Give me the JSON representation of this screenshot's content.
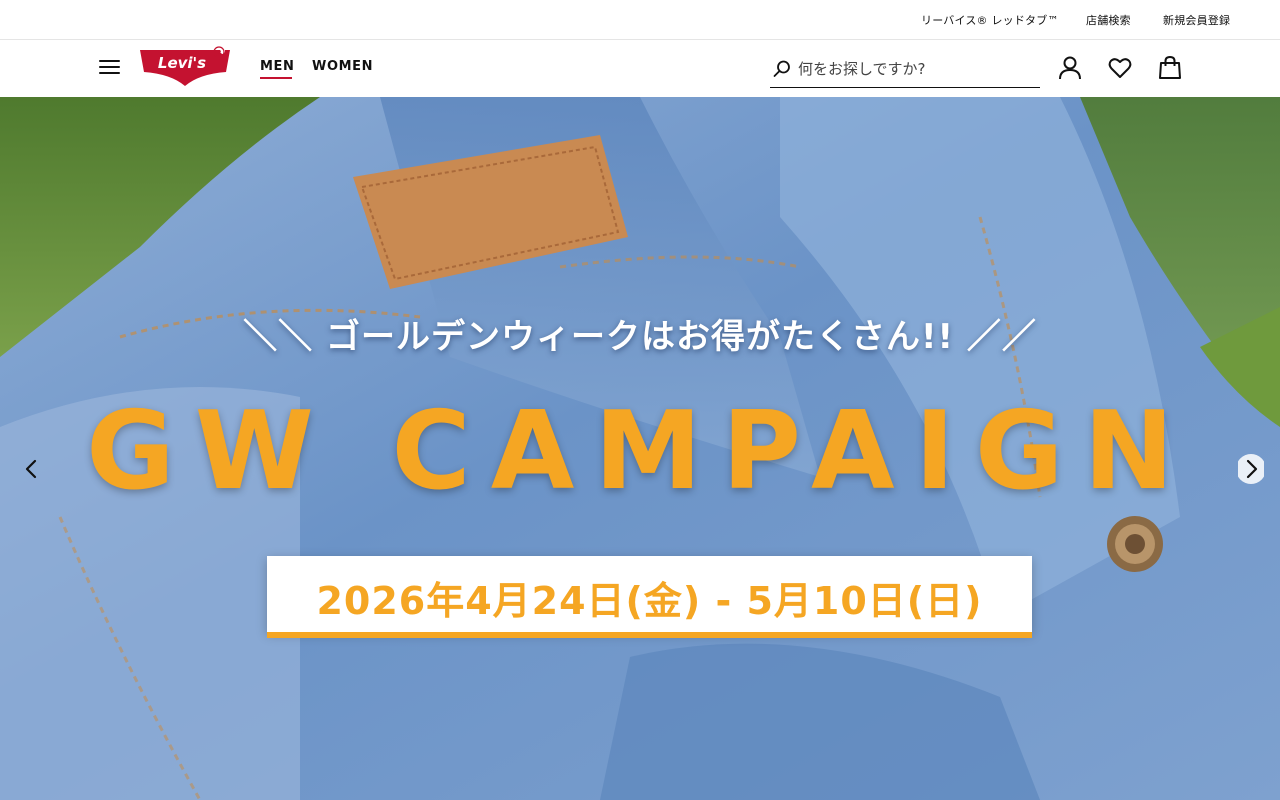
{
  "utility_bar": {
    "links": [
      {
        "label": "リーバイス® レッドタブ™"
      },
      {
        "label": "店舗検索"
      },
      {
        "label": "新規会員登録"
      }
    ]
  },
  "header": {
    "logo_text": "Levi's",
    "nav": [
      {
        "label": "MEN",
        "active": true
      },
      {
        "label": "WOMEN",
        "active": false
      }
    ],
    "search": {
      "placeholder": "何をお探しですか?",
      "value": ""
    },
    "icons": [
      "menu-icon",
      "search-icon",
      "account-icon",
      "wishlist-icon",
      "bag-icon"
    ]
  },
  "hero": {
    "subtitle": "＼＼ ゴールデンウィークはお得がたくさん!! ／／",
    "title": "GW CAMPAIGN",
    "dates": "2026年4月24日(金) - 5月10日(日)",
    "controls": [
      "chevron-left-icon",
      "chevron-right-icon"
    ]
  },
  "colors": {
    "brand_red": "#c41230",
    "campaign_orange": "#f5a623",
    "text": "#111111"
  }
}
